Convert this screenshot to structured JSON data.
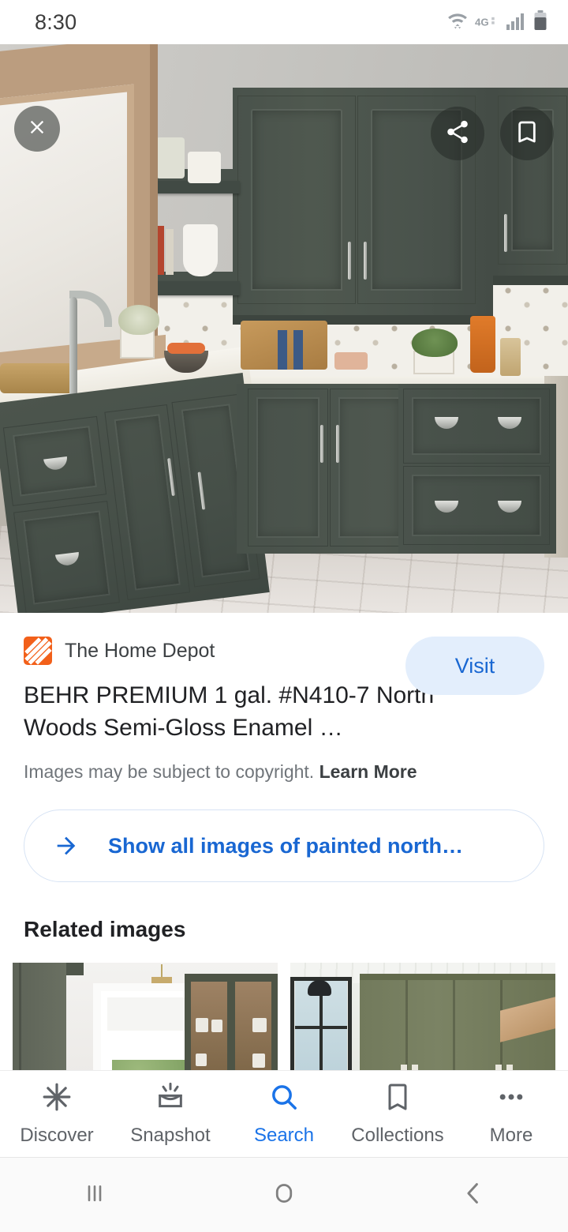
{
  "status_bar": {
    "time": "8:30",
    "icons": [
      "wifi-icon",
      "4g-icon",
      "signal-icon",
      "battery-icon"
    ],
    "network_label": "4G"
  },
  "hero": {
    "alt": "Kitchen with dark green painted cabinets, marble countertop and wood-look tile floor",
    "overlay_buttons": [
      {
        "name": "close-button",
        "icon": "close-icon"
      },
      {
        "name": "share-button",
        "icon": "share-icon"
      },
      {
        "name": "save-button",
        "icon": "bookmark-icon"
      }
    ]
  },
  "card": {
    "source_name": "The Home Depot",
    "source_logo": "home-depot-logo",
    "visit_label": "Visit",
    "title": "BEHR PREMIUM 1 gal. #N410-7 North Woods Semi-Gloss Enamel …",
    "copyright_text": "Images may be subject to copyright.",
    "learn_more_label": "Learn More"
  },
  "show_all": {
    "icon": "arrow-right-icon",
    "label": "Show all images of painted north…"
  },
  "related": {
    "heading": "Related images",
    "items": [
      {
        "name": "related-image-1",
        "alt": "White kitchen nook with dark green cabinets and glass-front cabinet"
      },
      {
        "name": "related-image-2",
        "alt": "Olive green tall cabinetry with black-framed window"
      }
    ]
  },
  "bottom_nav": {
    "items": [
      {
        "label": "Discover",
        "icon": "asterisk-icon",
        "active": false
      },
      {
        "label": "Snapshot",
        "icon": "snapshot-icon",
        "active": false
      },
      {
        "label": "Search",
        "icon": "search-icon",
        "active": true
      },
      {
        "label": "Collections",
        "icon": "bookmark-icon",
        "active": false
      },
      {
        "label": "More",
        "icon": "more-dots-icon",
        "active": false
      }
    ]
  },
  "system_nav": {
    "items": [
      {
        "name": "recents-button",
        "icon": "recents-icon"
      },
      {
        "name": "home-button",
        "icon": "home-icon"
      },
      {
        "name": "back-button",
        "icon": "back-icon"
      }
    ]
  },
  "colors": {
    "accent_blue": "#1a73e8",
    "link_blue": "#1967d2",
    "visit_bg": "#e3eefc",
    "text_primary": "#202124",
    "text_secondary": "#70757a",
    "brand_orange": "#f2601a",
    "cabinet_green": "#4a534c"
  }
}
